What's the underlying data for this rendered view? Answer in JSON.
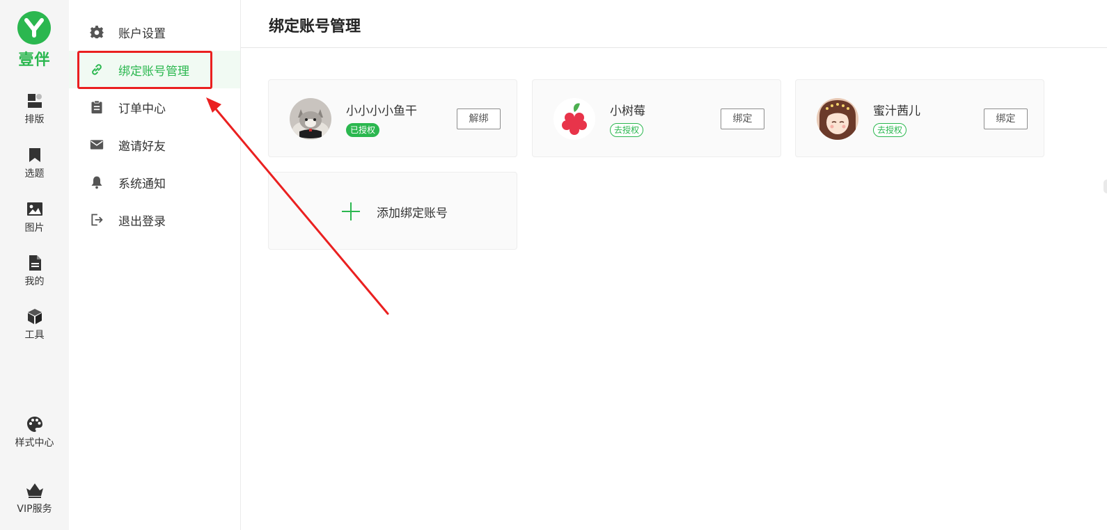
{
  "app": {
    "brand": "壹伴",
    "brand_color": "#2bb74f"
  },
  "rail": {
    "items": [
      {
        "label": "排版",
        "icon": "layout-icon"
      },
      {
        "label": "选题",
        "icon": "bookmark-icon"
      },
      {
        "label": "图片",
        "icon": "image-icon"
      },
      {
        "label": "我的",
        "icon": "document-icon"
      },
      {
        "label": "工具",
        "icon": "cube-icon"
      },
      {
        "label": "样式中心",
        "icon": "palette-icon"
      },
      {
        "label": "VIP服务",
        "icon": "crown-icon"
      }
    ]
  },
  "menu": {
    "items": [
      {
        "label": "账户设置",
        "icon": "gear-icon"
      },
      {
        "label": "绑定账号管理",
        "icon": "link-icon",
        "active": true
      },
      {
        "label": "订单中心",
        "icon": "clipboard-icon"
      },
      {
        "label": "邀请好友",
        "icon": "mail-icon"
      },
      {
        "label": "系统通知",
        "icon": "bell-icon"
      },
      {
        "label": "退出登录",
        "icon": "logout-icon"
      }
    ]
  },
  "page": {
    "title": "绑定账号管理"
  },
  "accounts": [
    {
      "name": "小小小小鱼干",
      "status": "已授权",
      "action": "解绑",
      "avatar": "cat-avatar"
    },
    {
      "name": "小树莓",
      "status": "去授权",
      "action": "绑定",
      "avatar": "raspberry-avatar"
    },
    {
      "name": "蜜汁茜儿",
      "status": "去授权",
      "action": "绑定",
      "avatar": "anime-girl-avatar"
    }
  ],
  "add_account": {
    "label": "添加绑定账号"
  },
  "annotation": {
    "box_color": "#ea2020",
    "arrow_color": "#ea2020"
  }
}
